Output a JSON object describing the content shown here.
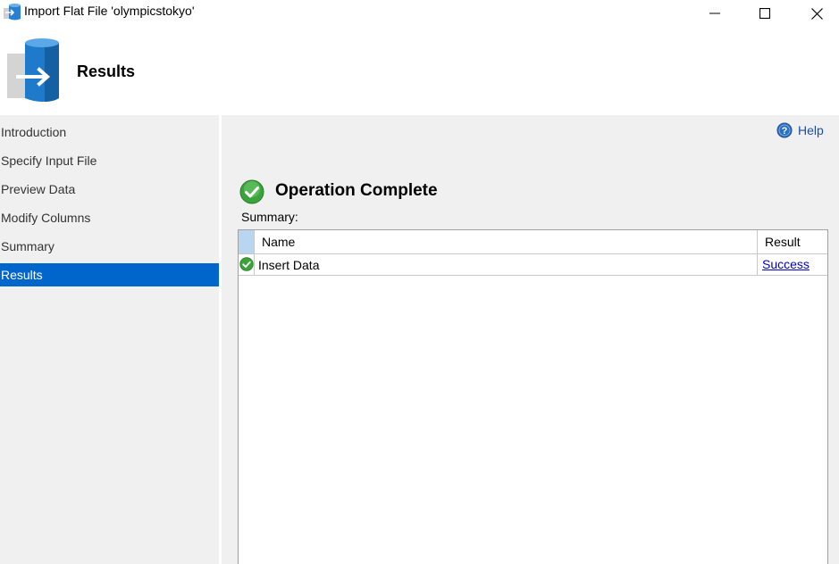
{
  "window": {
    "title": "Import Flat File 'olympicstokyo'",
    "controls": [
      "minimize-icon",
      "maximize-icon",
      "close-icon"
    ]
  },
  "header": {
    "title": "Results",
    "icon": "database-import-icon"
  },
  "sidebar": {
    "items": [
      {
        "label": "Introduction",
        "active": false
      },
      {
        "label": "Specify Input File",
        "active": false
      },
      {
        "label": "Preview Data",
        "active": false
      },
      {
        "label": "Modify Columns",
        "active": false
      },
      {
        "label": "Summary",
        "active": false
      },
      {
        "label": "Results",
        "active": true
      }
    ]
  },
  "main": {
    "help_label": "Help",
    "status_title": "Operation Complete",
    "summary_label": "Summary:",
    "table": {
      "columns": [
        "Name",
        "Result"
      ],
      "rows": [
        {
          "name": "Insert Data",
          "result": "Success",
          "status_icon": "success-check-icon"
        }
      ]
    }
  },
  "colors": {
    "accent": "#0066cc",
    "panel_bg": "#f0f0f0",
    "link": "#0000cc",
    "success": "#3ca23c"
  }
}
